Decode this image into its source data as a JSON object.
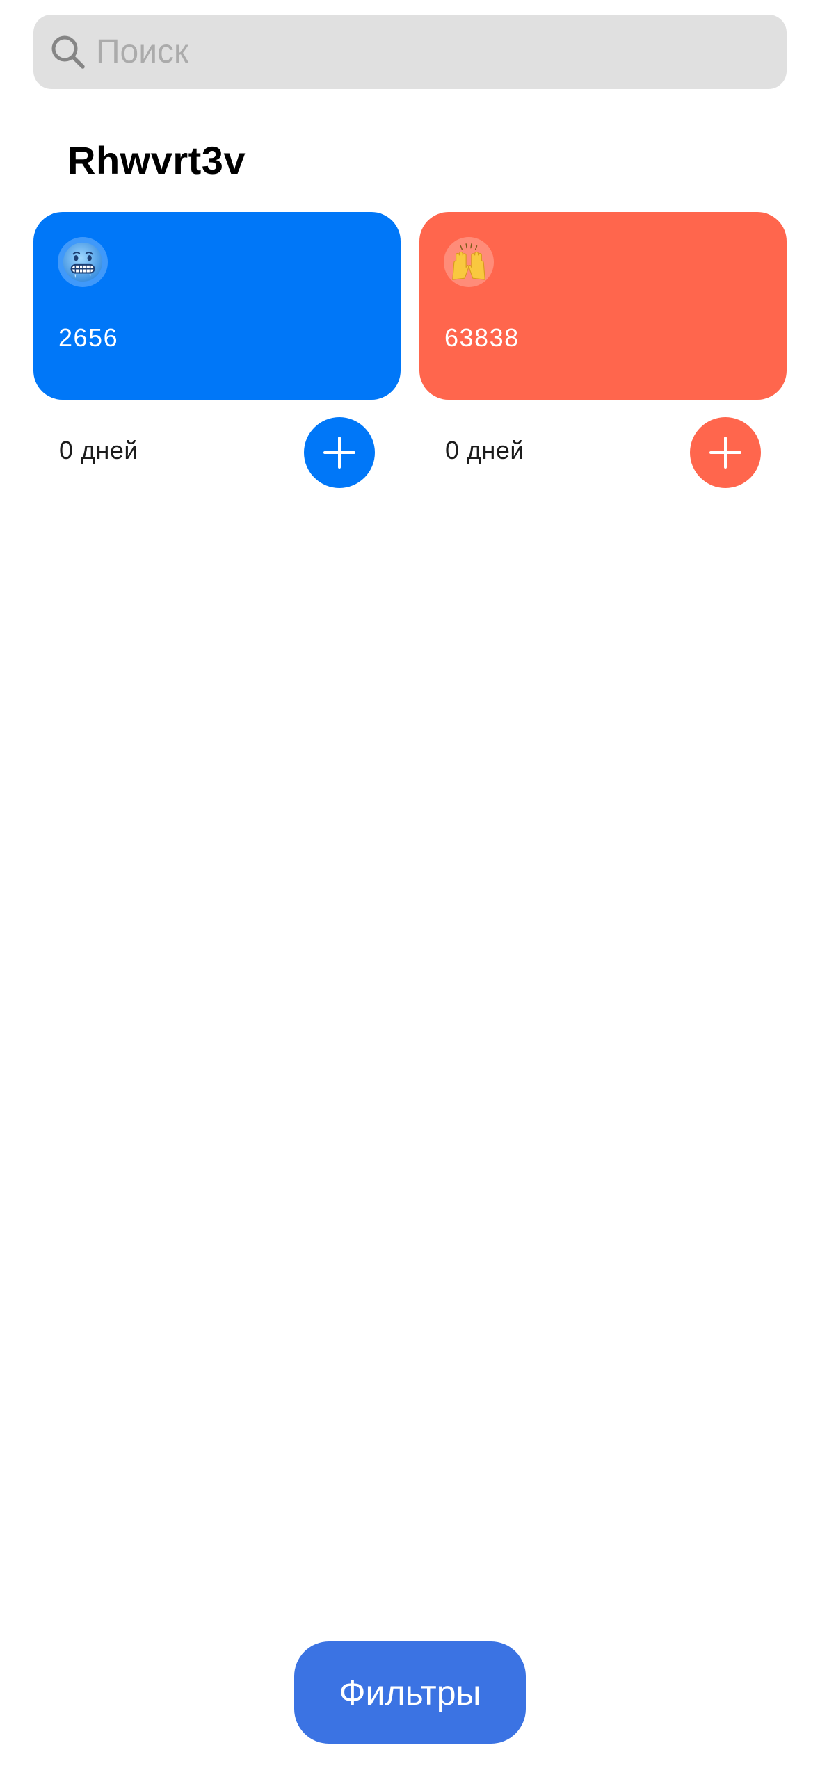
{
  "search": {
    "placeholder": "Поиск",
    "value": "",
    "icon": "search-icon"
  },
  "section": {
    "title": "Rhwvrt3v"
  },
  "cards": [
    {
      "emoji": "cold-face-emoji",
      "number": "2656",
      "days_label": "0 дней",
      "color": "#0077f8",
      "add_icon": "plus-icon"
    },
    {
      "emoji": "raising-hands-emoji",
      "number": "63838",
      "days_label": "0 дней",
      "color": "#ff664d",
      "add_icon": "plus-icon"
    }
  ],
  "footer": {
    "filters_label": "Фильтры",
    "color": "#3b73e3"
  }
}
